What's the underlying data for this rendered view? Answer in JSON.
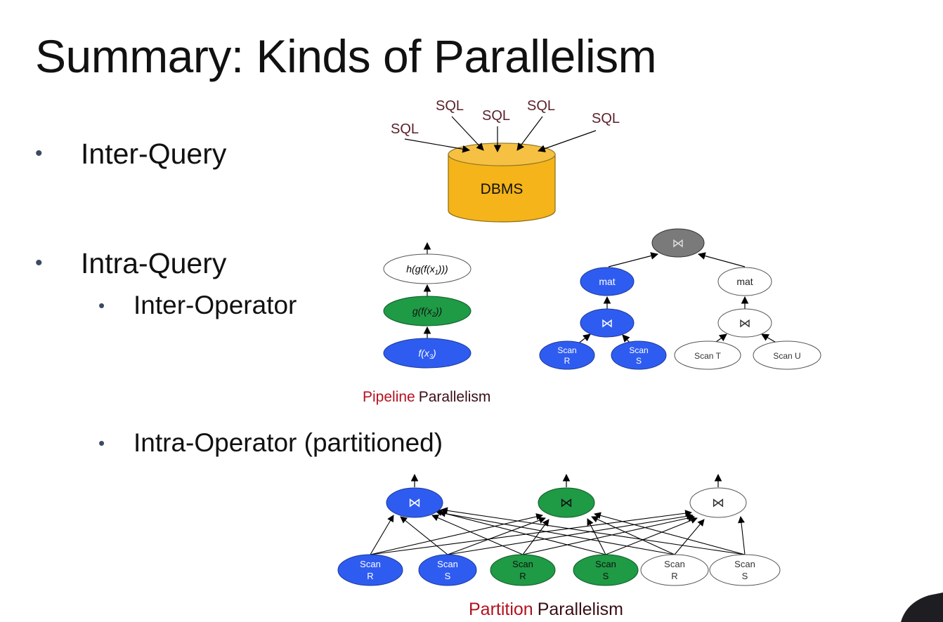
{
  "slide": {
    "title": "Summary: Kinds of Parallelism",
    "bullets": {
      "inter_query": "Inter-Query",
      "intra_query": "Intra-Query",
      "inter_operator": "Inter-Operator",
      "intra_operator": "Intra-Operator (partitioned)"
    }
  },
  "inter_query_diagram": {
    "sql_label": "SQL",
    "db_label": "DBMS",
    "db_color": "#f4b41a"
  },
  "pipeline_diagram": {
    "nodes": [
      "h(g(f(x1)))",
      "g(f(x2))",
      "f(x3)"
    ],
    "subscripts": [
      "1",
      "2",
      "3"
    ],
    "caption_highlight": "Pipeline",
    "caption_rest": "Parallelism"
  },
  "tree_diagram": {
    "join_symbol": "⋈",
    "mat_label": "mat",
    "scan_label": "Scan",
    "r": "R",
    "s": "S",
    "scan_t": "Scan T",
    "scan_u": "Scan U"
  },
  "partition_diagram": {
    "join_symbol": "⋈",
    "scan_label": "Scan",
    "r": "R",
    "s": "S",
    "caption_highlight": "Partition",
    "caption_rest": "Parallelism"
  },
  "colors": {
    "blue": "#2f5cf0",
    "green": "#1f9a45",
    "gray": "#7a7a7a",
    "highlight_red": "#b3121f",
    "caption_dark": "#3a0f16"
  }
}
